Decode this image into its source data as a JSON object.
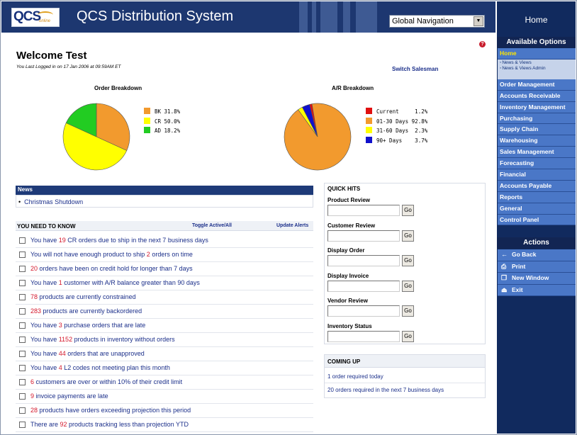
{
  "header": {
    "logo_text": "QCS",
    "logo_sub": "online",
    "title": "QCS Distribution System",
    "global_nav": {
      "selected": "Global Navigation"
    }
  },
  "sidebar": {
    "home_title": "Home",
    "available_options_title": "Available Options",
    "options": [
      {
        "label": "Home",
        "active": true
      },
      {
        "label": "Order Management"
      },
      {
        "label": "Accounts Receivable"
      },
      {
        "label": "Inventory Management"
      },
      {
        "label": "Purchasing"
      },
      {
        "label": "Supply Chain"
      },
      {
        "label": "Warehousing"
      },
      {
        "label": "Sales Management"
      },
      {
        "label": "Forecasting"
      },
      {
        "label": "Financial"
      },
      {
        "label": "Accounts Payable"
      },
      {
        "label": "Reports"
      },
      {
        "label": "General"
      },
      {
        "label": "Control Panel"
      }
    ],
    "home_sub": [
      "News & Views",
      "News & Views Admin"
    ],
    "actions_title": "Actions",
    "actions": [
      {
        "label": "Go Back",
        "icon": "arrow-left-icon"
      },
      {
        "label": "Print",
        "icon": "printer-icon"
      },
      {
        "label": "New Window",
        "icon": "new-window-icon"
      },
      {
        "label": "Exit",
        "icon": "exit-icon"
      }
    ]
  },
  "welcome": {
    "title": "Welcome Test",
    "last_login": "You Last Logged in on 17 Jan 2006 at 09:59AM ET",
    "switch_salesman": "Switch Salesman"
  },
  "chart_data": [
    {
      "type": "pie",
      "title": "Order Breakdown",
      "slices": [
        {
          "label": "BK",
          "value": 31.8,
          "display": "BK 31.8%",
          "color": "#f29a2e"
        },
        {
          "label": "CR",
          "value": 50.0,
          "display": "CR 50.0%",
          "color": "#ffff00"
        },
        {
          "label": "AD",
          "value": 18.2,
          "display": "AD 18.2%",
          "color": "#22cc22"
        }
      ]
    },
    {
      "type": "pie",
      "title": "A/R Breakdown",
      "slices": [
        {
          "label": "Current",
          "value": 1.2,
          "display": "Current     1.2%",
          "color": "#e01010"
        },
        {
          "label": "01-30 Days",
          "value": 92.8,
          "display": "01-30 Days 92.8%",
          "color": "#f29a2e"
        },
        {
          "label": "31-60 Days",
          "value": 2.3,
          "display": "31-60 Days  2.3%",
          "color": "#ffff00"
        },
        {
          "label": "90+ Days",
          "value": 3.7,
          "display": "90+ Days    3.7%",
          "color": "#1010cc"
        }
      ]
    }
  ],
  "news": {
    "title": "News",
    "items": [
      "Christmas Shutdown"
    ]
  },
  "ynk": {
    "title": "YOU NEED TO KNOW",
    "toggle": "Toggle Active/All",
    "update": "Update Alerts",
    "items": [
      {
        "pre": "You have ",
        "num": "19",
        "post": " CR orders due to ship in the next 7 business days"
      },
      {
        "pre": "You will not have enough product to ship ",
        "num": "2",
        "post": " orders on time"
      },
      {
        "pre": "",
        "num": "20",
        "post": " orders have been on credit hold for longer than 7 days"
      },
      {
        "pre": "You have ",
        "num": "1",
        "post": " customer with A/R balance greater than 90 days"
      },
      {
        "pre": "",
        "num": "78",
        "post": " products are currently constrained"
      },
      {
        "pre": "",
        "num": "283",
        "post": " products are currently backordered"
      },
      {
        "pre": "You have ",
        "num": "3",
        "post": " purchase orders that are late"
      },
      {
        "pre": "You have ",
        "num": "1152",
        "post": " products in inventory without orders"
      },
      {
        "pre": "You have ",
        "num": "44",
        "post": " orders that are unapproved"
      },
      {
        "pre": "You have ",
        "num": "4",
        "post": " L2 codes not meeting plan this month"
      },
      {
        "pre": "",
        "num": "6",
        "post": " customers are over or within 10% of their credit limit"
      },
      {
        "pre": "",
        "num": "9",
        "post": " invoice payments are late"
      },
      {
        "pre": "",
        "num": "28",
        "post": " products have orders exceeding projection this period"
      },
      {
        "pre": "There are ",
        "num": "92",
        "post": " products tracking less than projection YTD"
      }
    ]
  },
  "quick_hits": {
    "title": "QUICK HITS",
    "go_label": "Go",
    "fields": [
      {
        "label": "Product Review",
        "value": ""
      },
      {
        "label": "Customer Review",
        "value": ""
      },
      {
        "label": "Display Order",
        "value": ""
      },
      {
        "label": "Display Invoice",
        "value": ""
      },
      {
        "label": "Vendor Review",
        "value": ""
      },
      {
        "label": "Inventory Status",
        "value": ""
      }
    ]
  },
  "coming_up": {
    "title": "COMING UP",
    "items": [
      "1 order required today",
      "20 orders required in the next 7 business days"
    ]
  }
}
